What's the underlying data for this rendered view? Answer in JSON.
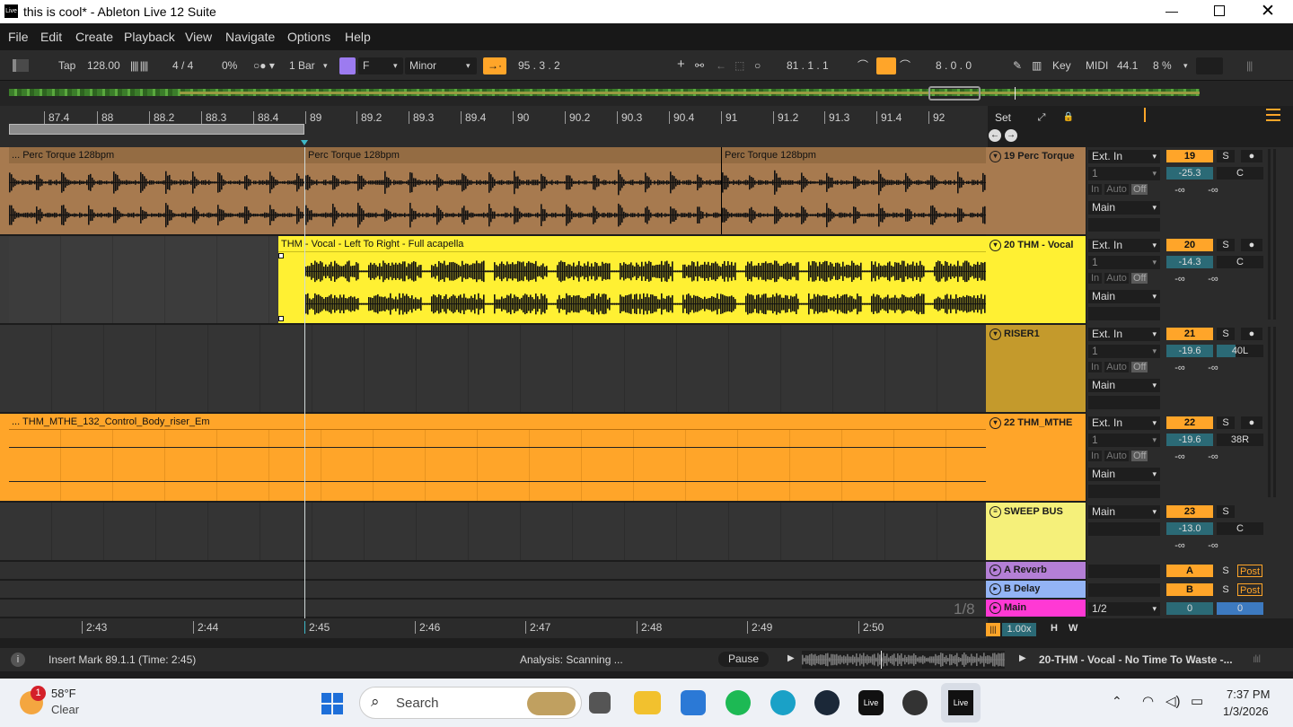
{
  "window": {
    "title": "this is cool* - Ableton Live 12 Suite",
    "app_icon": "Live"
  },
  "menu": [
    "File",
    "Edit",
    "Create",
    "Playback",
    "View",
    "Navigate",
    "Options",
    "Help"
  ],
  "control_bar": {
    "tap": "Tap",
    "tempo": "128.00",
    "signature": "4 / 4",
    "swing": "0%",
    "quantize": "1 Bar",
    "key": "F",
    "scale": "Minor",
    "arrangement_position": "95 . 3 . 2",
    "loop_start": "81 . 1 . 1",
    "loop_length": "8 . 0 . 0",
    "key_label": "Key",
    "midi_label": "MIDI",
    "sample_rate": "44.1",
    "cpu": "8 %"
  },
  "ruler": {
    "bars": [
      "87.4",
      "88",
      "88.2",
      "88.3",
      "88.4",
      "89",
      "89.2",
      "89.3",
      "89.4",
      "90",
      "90.2",
      "90.3",
      "90.4",
      "91",
      "91.2",
      "91.3",
      "91.4",
      "92"
    ],
    "set_button": "Set"
  },
  "tracks": [
    {
      "clips": [
        "... Perc Torque 128bpm",
        "Perc Torque 128bpm",
        "Perc Torque 128bpm"
      ],
      "name": "19 Perc Torque",
      "color": "#a77a4f",
      "input": "Ext. In",
      "channel": "1",
      "monitor": [
        "In",
        "Auto",
        "Off"
      ],
      "output": "Main",
      "number": "19",
      "volume": "-25.3",
      "pan": "C",
      "peak1": "-∞",
      "peak2": "-∞",
      "solo": "S"
    },
    {
      "clips": [
        "THM - Vocal - Left To Right - Full acapella"
      ],
      "name": "20 THM - Vocal",
      "color": "#fff033",
      "input": "Ext. In",
      "channel": "1",
      "monitor": [
        "In",
        "Auto",
        "Off"
      ],
      "output": "Main",
      "number": "20",
      "volume": "-14.3",
      "pan": "C",
      "peak1": "-∞",
      "peak2": "-∞",
      "solo": "S"
    },
    {
      "clips": [],
      "name": "RISER1",
      "color": "#c49a2c",
      "input": "Ext. In",
      "channel": "1",
      "monitor": [
        "In",
        "Auto",
        "Off"
      ],
      "output": "Main",
      "number": "21",
      "volume": "-19.6",
      "pan": "40L",
      "peak1": "-∞",
      "peak2": "-∞",
      "solo": "S"
    },
    {
      "clips": [
        "... THM_MTHE_132_Control_Body_riser_Em"
      ],
      "name": "22 THM_MTHE",
      "color": "#ffa529",
      "input": "Ext. In",
      "channel": "1",
      "monitor": [
        "In",
        "Auto",
        "Off"
      ],
      "output": "Main",
      "number": "22",
      "volume": "-19.6",
      "pan": "38R",
      "peak1": "-∞",
      "peak2": "-∞",
      "solo": "S"
    },
    {
      "clips": [],
      "name": "SWEEP BUS",
      "color": "#f5f07a",
      "output": "Main",
      "number": "23",
      "volume": "-13.0",
      "pan": "C",
      "peak1": "-∞",
      "peak2": "-∞",
      "solo": "S"
    }
  ],
  "returns": [
    {
      "name": "A Reverb",
      "color": "#b47fd6",
      "letter": "A",
      "solo": "S",
      "post": "Post"
    },
    {
      "name": "B Delay",
      "color": "#93b4f5",
      "letter": "B",
      "solo": "S",
      "post": "Post"
    },
    {
      "name": "Main",
      "color": "#ff39d4",
      "output": "1/2",
      "vol": "0",
      "pan": "0",
      "grid": "1/8"
    }
  ],
  "time_axis": [
    "2:43",
    "2:44",
    "2:45",
    "2:46",
    "2:47",
    "2:48",
    "2:49",
    "2:50"
  ],
  "zoom": {
    "value": "1.00x",
    "h": "H",
    "w": "W"
  },
  "status": {
    "message": "Insert Mark 89.1.1 (Time: 2:45)",
    "analysis": "Analysis: Scanning ...",
    "pause": "Pause",
    "clip": "20-THM - Vocal - No Time To Waste -..."
  },
  "taskbar": {
    "weather_temp": "58°F",
    "weather_desc": "Clear",
    "notif": "1",
    "search": "Search",
    "time": "7:37 PM",
    "date": "1/3/2026",
    "live_label": "Live"
  }
}
